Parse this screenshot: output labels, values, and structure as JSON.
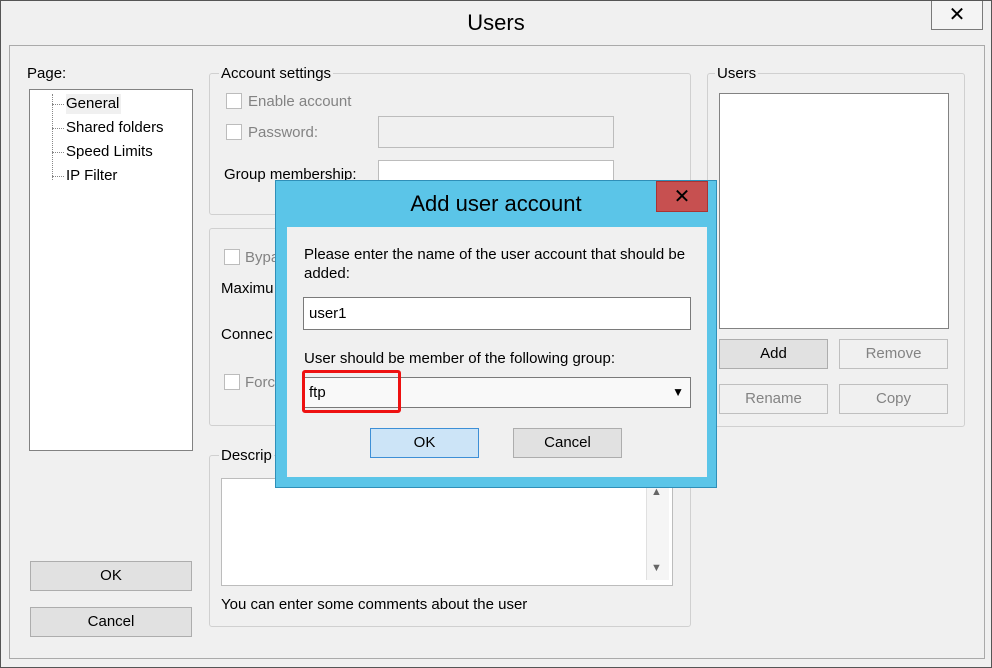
{
  "window": {
    "title": "Users",
    "close_glyph": "✕"
  },
  "page_panel": {
    "label": "Page:",
    "items": [
      "General",
      "Shared folders",
      "Speed Limits",
      "IP Filter"
    ],
    "ok_label": "OK",
    "cancel_label": "Cancel"
  },
  "account_settings": {
    "label": "Account settings",
    "enable_account": "Enable account",
    "password": "Password:",
    "group_membership": "Group membership:"
  },
  "limits_group": {
    "bypass": "Bypa",
    "maximum": "Maximu",
    "connections": "Connec",
    "force": "Forc"
  },
  "description_group": {
    "label": "Descrip",
    "hint": "You can enter some comments about the user"
  },
  "users_panel": {
    "label": "Users",
    "add": "Add",
    "remove": "Remove",
    "rename": "Rename",
    "copy": "Copy"
  },
  "dialog": {
    "title": "Add user account",
    "close_glyph": "✕",
    "prompt": "Please enter the name of the user account that should be added:",
    "username_value": "user1",
    "group_prompt": "User should be member of the following group:",
    "group_value": "ftp",
    "ok": "OK",
    "cancel": "Cancel"
  },
  "colors": {
    "dialog_frame": "#5bc5e8",
    "close_red": "#c75050",
    "highlight": "#ee1111"
  }
}
